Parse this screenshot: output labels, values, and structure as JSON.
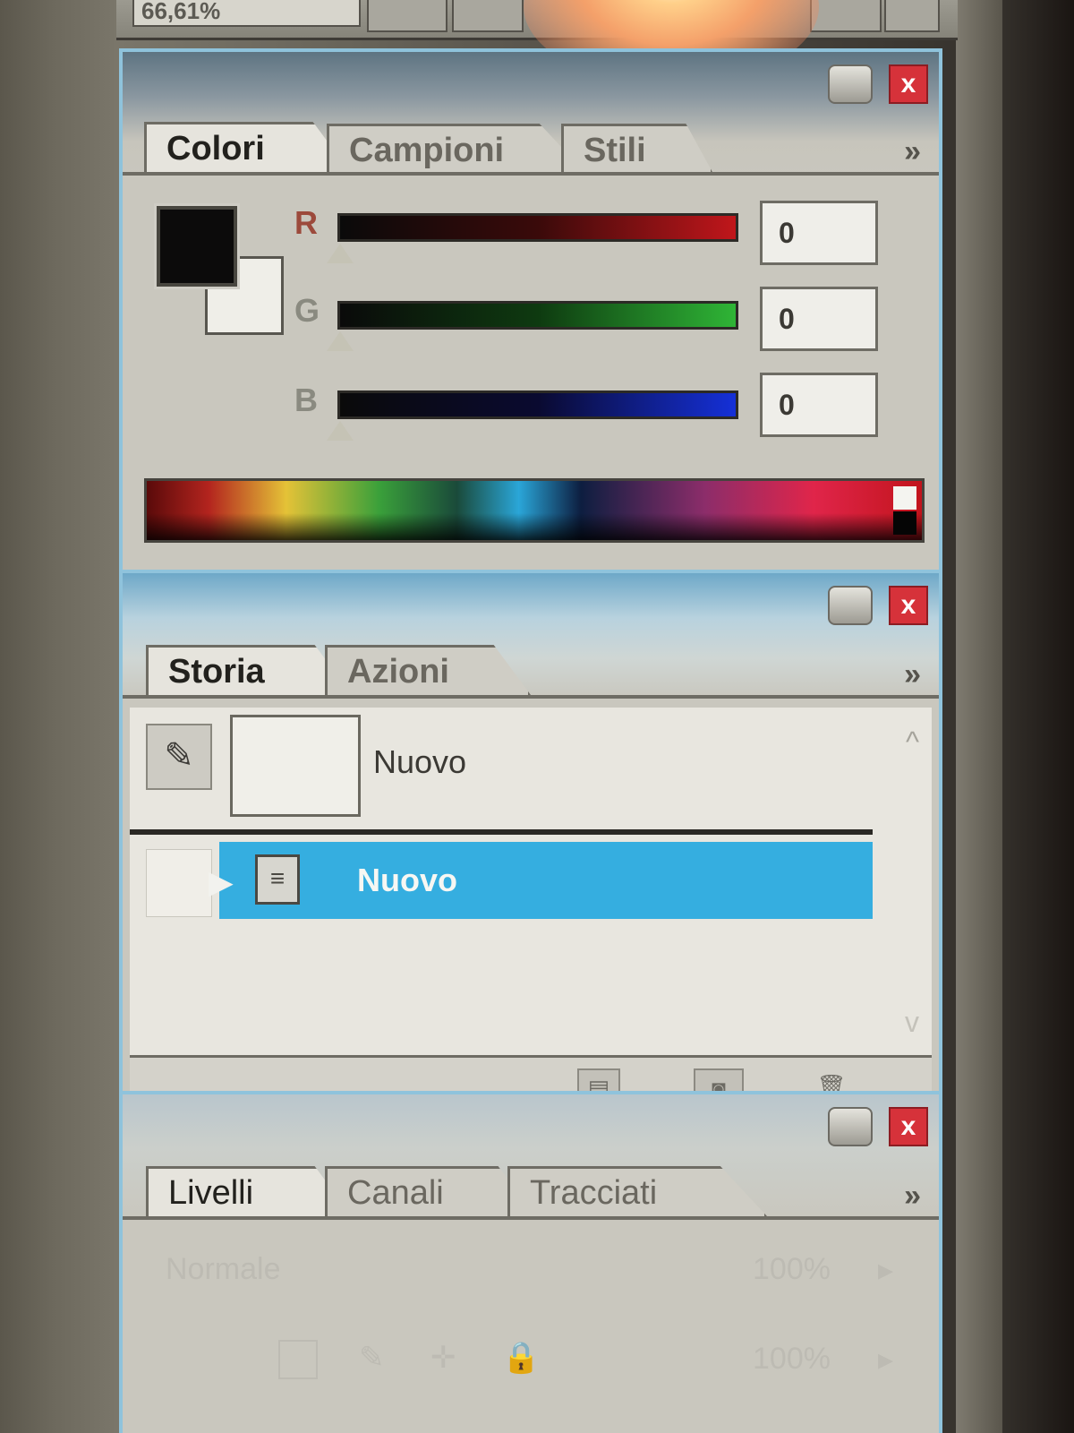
{
  "toolbar": {
    "zoom": "66,61%"
  },
  "colors_panel": {
    "tabs": [
      "Colori",
      "Campioni",
      "Stili"
    ],
    "more": "»",
    "close": "x",
    "channels": [
      {
        "label": "R",
        "value": "0",
        "color": "#c0161b"
      },
      {
        "label": "G",
        "value": "0",
        "color": "#2fb536"
      },
      {
        "label": "B",
        "value": "0",
        "color": "#1530d8"
      }
    ]
  },
  "history_panel": {
    "tabs": [
      "Storia",
      "Azioni"
    ],
    "more": "»",
    "close": "x",
    "snapshot_label": "Nuovo",
    "items": [
      {
        "label": "Nuovo",
        "selected": true
      }
    ],
    "scroll_up": "^",
    "scroll_down": "v"
  },
  "layers_panel": {
    "tabs": [
      "Livelli",
      "Canali",
      "Tracciati"
    ],
    "more": "»",
    "close": "x",
    "blend_mode": "Normale",
    "opacity": "100%",
    "fill": "100%"
  },
  "icons": {
    "brush": "brush-icon",
    "document": "document-icon",
    "new_document_from_state": "new-document-icon",
    "snapshot": "camera-icon",
    "trash": "trash-icon"
  },
  "accent": {
    "selection": "#35aee0",
    "close": "#d6323a",
    "panel_border": "#8fc3dc"
  }
}
